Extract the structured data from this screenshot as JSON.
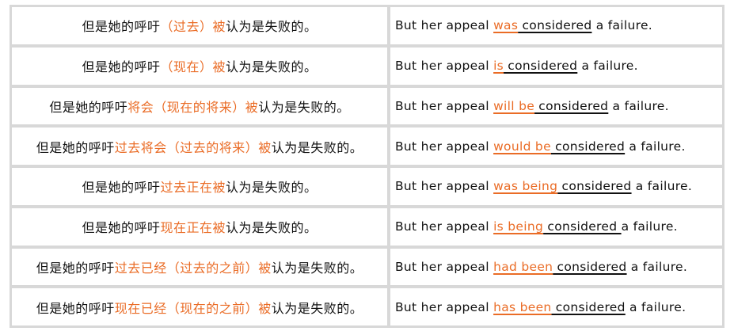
{
  "colors": {
    "highlight": "#ea6c26",
    "text": "#111111",
    "grid": "#d8d8d8"
  },
  "rows": [
    {
      "zh_prefix": "但是她的呼吁",
      "zh_highlight": "（过去）被",
      "zh_suffix": "认为是失败的。",
      "en_prefix": "But her appeal ",
      "en_aux": "was",
      "en_verb": " considered",
      "en_suffix": " a failure."
    },
    {
      "zh_prefix": "但是她的呼吁",
      "zh_highlight": "（现在）被",
      "zh_suffix": "认为是失败的。",
      "en_prefix": "But her appeal ",
      "en_aux": "is",
      "en_verb": " considered",
      "en_suffix": " a failure."
    },
    {
      "zh_prefix": "但是她的呼吁",
      "zh_highlight": "将会（现在的将来）被",
      "zh_suffix": "认为是失败的。",
      "en_prefix": "But her appeal ",
      "en_aux": "will be",
      "en_verb": " considered",
      "en_suffix": " a failure."
    },
    {
      "zh_prefix": "但是她的呼吁",
      "zh_highlight": "过去将会（过去的将来）被",
      "zh_suffix": "认为是失败的。",
      "en_prefix": "But her appeal ",
      "en_aux": "would be",
      "en_verb": " considered",
      "en_suffix": " a failure."
    },
    {
      "zh_prefix": "但是她的呼吁",
      "zh_highlight": "过去正在被",
      "zh_suffix": "认为是失败的。",
      "en_prefix": "But her appeal ",
      "en_aux": "was being",
      "en_verb": " considered",
      "en_suffix": " a failure."
    },
    {
      "zh_prefix": "但是她的呼吁",
      "zh_highlight": "现在正在被",
      "zh_suffix": "认为是失败的。",
      "en_prefix": "But her appeal ",
      "en_aux": "is being",
      "en_verb": " considered ",
      "en_suffix": "a failure."
    },
    {
      "zh_prefix": "但是她的呼吁",
      "zh_highlight": "过去已经（过去的之前）被",
      "zh_suffix": "认为是失败的。",
      "en_prefix": "But her appeal ",
      "en_aux": "had been",
      "en_verb": " considered",
      "en_suffix": " a failure."
    },
    {
      "zh_prefix": "但是她的呼吁",
      "zh_highlight": "现在已经（现在的之前）被",
      "zh_suffix": "认为是失败的。",
      "en_prefix": "But her appeal ",
      "en_aux": "has been",
      "en_verb": " considered",
      "en_suffix": " a failure."
    }
  ]
}
